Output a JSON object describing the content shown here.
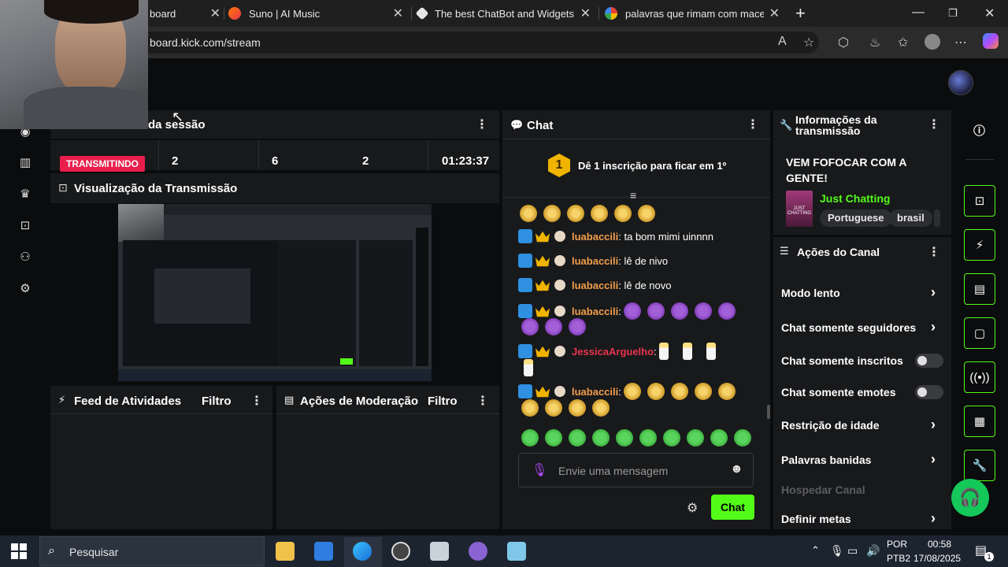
{
  "browser": {
    "tabs": [
      {
        "title": "board",
        "icon": "kick-icon"
      },
      {
        "title": "Suno | AI Music",
        "icon": "suno-icon"
      },
      {
        "title": "The best ChatBot and Widgets fo",
        "icon": "botrix-icon"
      },
      {
        "title": "palavras que rimam com macetar",
        "icon": "google-icon"
      }
    ],
    "url": "board.kick.com/stream"
  },
  "session": {
    "title": "da sessão",
    "status": "TRANSMITINDO",
    "stats": [
      "2",
      "6",
      "2",
      "01:23:37"
    ]
  },
  "preview": {
    "title": "Visualização da Transmissão"
  },
  "feed": {
    "title": "Feed de Atividades",
    "filter": "Filtro"
  },
  "moderation": {
    "title": "Ações de Moderação",
    "filter": "Filtro"
  },
  "chat": {
    "title": "Chat",
    "goal_number": "1",
    "goal_text": "Dê 1 inscrição para ficar em 1º",
    "messages": [
      {
        "user": "luabaccili",
        "text": "ta bom mimi uinnnn",
        "color": "#f29e4c"
      },
      {
        "user": "luabaccili",
        "text": "lê de nivo",
        "color": "#f29e4c"
      },
      {
        "user": "luabaccili",
        "text": "lê de novo",
        "color": "#f29e4c"
      },
      {
        "user": "luabaccili",
        "text": "",
        "color": "#f29e4c"
      },
      {
        "user": "JessicaArguelho",
        "text": "",
        "color": "#e8344e"
      },
      {
        "user": "luabaccili",
        "text": "",
        "color": "#f29e4c"
      }
    ],
    "input_placeholder": "Envie uma mensagem",
    "send_label": "Chat"
  },
  "stream_info": {
    "title_line1": "Informações da",
    "title_line2": "transmissão",
    "stream_title": "VEM FOFOCAR COM A GENTE!",
    "category": "Just Chatting",
    "category_thumb_text": "JUST CHATTING",
    "tags": [
      "Portuguese",
      "brasil"
    ]
  },
  "channel_actions": {
    "title": "Ações do Canal",
    "items": [
      {
        "label": "Modo lento",
        "control": "chevron"
      },
      {
        "label": "Chat somente seguidores",
        "control": "chevron"
      },
      {
        "label": "Chat somente inscritos",
        "control": "toggle"
      },
      {
        "label": "Chat somente emotes",
        "control": "toggle"
      },
      {
        "label": "Restrição de idade",
        "control": "chevron"
      },
      {
        "label": "Palavras banidas",
        "control": "chevron"
      },
      {
        "label": "Hospedar Canal",
        "control": "disabled"
      },
      {
        "label": "Definir metas",
        "control": "chevron"
      }
    ]
  },
  "taskbar": {
    "search_placeholder": "Pesquisar",
    "lang_line1": "POR",
    "lang_line2": "PTB2",
    "time": "00:58",
    "date": "17/08/2025",
    "notification_count": "1"
  },
  "colors": {
    "accent": "#53fc18",
    "live": "#e91e4c",
    "panel": "#18191b"
  }
}
